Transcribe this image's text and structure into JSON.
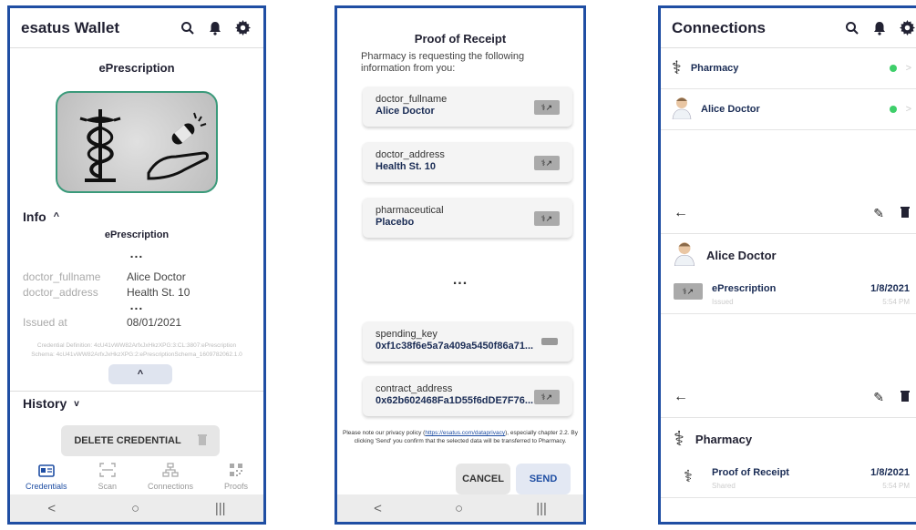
{
  "colors": {
    "accent": "#1f4ea3",
    "frame": "#1f4ea3",
    "status_online": "#3ecf6a",
    "image_border": "#3a9a7a"
  },
  "screen1": {
    "app_title": "esatus Wallet",
    "header_icons": [
      "search-icon",
      "bell-icon",
      "gear-icon"
    ],
    "credential_title": "ePrescription",
    "info": {
      "label": "Info",
      "credential_name": "ePrescription",
      "dots": "...",
      "fields": [
        {
          "label": "doctor_fullname",
          "value": "Alice Doctor"
        },
        {
          "label": "doctor_address",
          "value": "Health St. 10"
        }
      ],
      "dots2": "...",
      "issued_label": "Issued at",
      "issued_value": "08/01/2021",
      "definition_line": "Credential Definition: 4cU41vWW82ArfxJxHkzXPG:3:CL:3807:ePrescription",
      "schema_line": "Schema: 4cU41vWW82ArfxJxHkzXPG:2:ePrescriptionSchema_1609782062.1.0"
    },
    "history_label": "History",
    "delete_label": "DELETE CREDENTIAL",
    "tabs": [
      {
        "label": "Credentials",
        "icon": "id-card-icon",
        "active": true
      },
      {
        "label": "Scan",
        "icon": "scan-icon",
        "active": false
      },
      {
        "label": "Connections",
        "icon": "network-icon",
        "active": false
      },
      {
        "label": "Proofs",
        "icon": "qr-code-icon",
        "active": false
      }
    ]
  },
  "screen2": {
    "title": "Proof of Receipt",
    "subtitle": "Pharmacy is requesting the following information from you:",
    "attributes": [
      {
        "key": "doctor_fullname",
        "value": "Alice Doctor",
        "icon": "prescription-icon"
      },
      {
        "key": "doctor_address",
        "value": "Health St. 10",
        "icon": "prescription-icon"
      },
      {
        "key": "pharmaceutical",
        "value": "Placebo",
        "icon": "prescription-icon"
      }
    ],
    "dots": "...",
    "attributes2": [
      {
        "key": "spending_key",
        "value": "0xf1c38f6e5a7a409a5450f86a71...",
        "icon": "key-card-icon"
      },
      {
        "key": "contract_address",
        "value": "0x62b602468Fa1D55f6dDE7F76...",
        "icon": "prescription-icon"
      }
    ],
    "note_pre": "Please note our privacy policy (",
    "note_link": "https://esatus.com/dataprivacy",
    "note_post": "), especially chapter 2.2. By clicking 'Send' you confirm that the selected data will be transferred to Pharmacy.",
    "cancel_label": "CANCEL",
    "send_label": "SEND"
  },
  "screen3": {
    "title": "Connections",
    "connections": [
      {
        "name": "Pharmacy",
        "icon": "caduceus-icon",
        "status": "online"
      },
      {
        "name": "Alice Doctor",
        "icon": "doctor-avatar-icon",
        "status": "online"
      }
    ],
    "detail1": {
      "name": "Alice Doctor",
      "item_title": "ePrescription",
      "item_status": "Issued",
      "item_date": "1/8/2021",
      "item_time": "5:54 PM"
    },
    "detail2": {
      "name": "Pharmacy",
      "item_title": "Proof of Receipt",
      "item_status": "Shared",
      "item_date": "1/8/2021",
      "item_time": "5:54 PM"
    }
  }
}
